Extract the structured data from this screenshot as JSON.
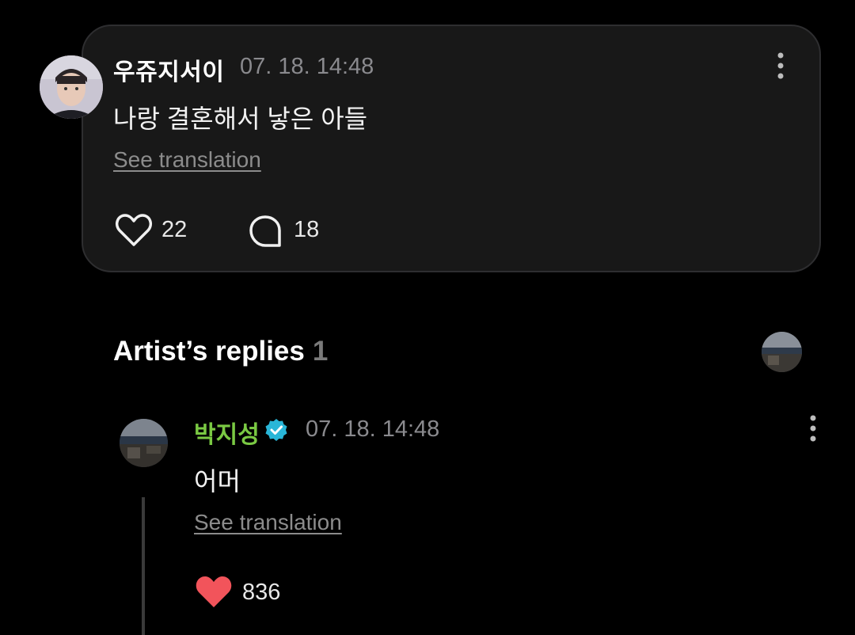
{
  "comment": {
    "username": "우쥬지서이",
    "timestamp": "07. 18. 14:48",
    "text": "나랑 결혼해서 낳은 아들",
    "see_translation": "See translation",
    "like_count": "22",
    "reply_count": "18"
  },
  "artist_replies": {
    "title": "Artist’s replies",
    "count": "1"
  },
  "artist_reply": {
    "username": "박지성",
    "timestamp": "07. 18. 14:48",
    "text": "어머",
    "see_translation": "See translation",
    "like_count": "836"
  },
  "icons": {
    "like": "heart-outline-icon",
    "comment": "speech-bubble-icon",
    "liked": "heart-filled-icon",
    "verified": "verified-badge-icon",
    "more": "more-vertical-icon"
  },
  "colors": {
    "background": "#000000",
    "card": "#181818",
    "artist_name": "#7ac943",
    "liked_heart": "#f2545b",
    "verified": "#29b6d8"
  }
}
